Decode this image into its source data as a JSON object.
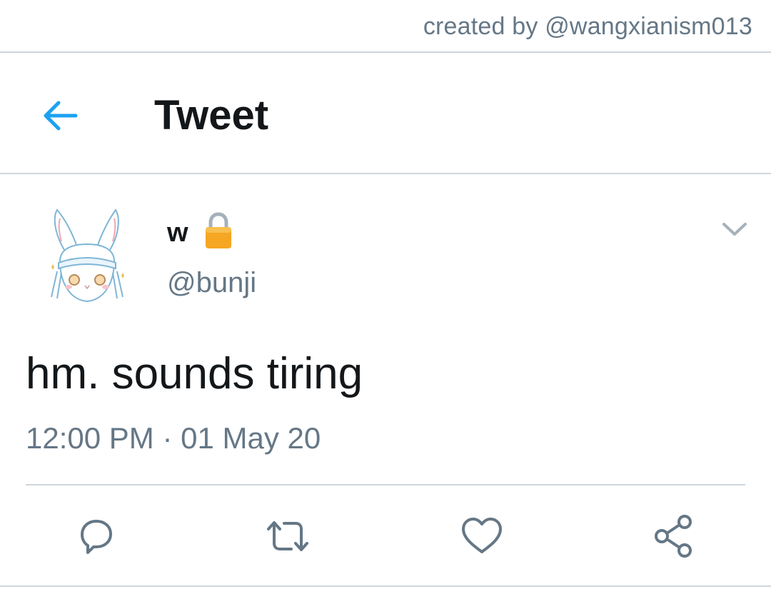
{
  "credit": "created by @wangxianism013",
  "header": {
    "title": "Tweet",
    "back_icon": "back-arrow-icon"
  },
  "tweet": {
    "display_name": "w",
    "protected_icon": "lock-icon",
    "handle": "@bunji",
    "text": "hm. sounds tiring",
    "time": "12:00 PM",
    "separator": "·",
    "date": "01 May 20"
  },
  "actions": [
    {
      "icon": "reply-icon"
    },
    {
      "icon": "retweet-icon"
    },
    {
      "icon": "like-icon"
    },
    {
      "icon": "share-icon"
    }
  ],
  "colors": {
    "accent": "#1da1f2",
    "text_primary": "#14171a",
    "text_secondary": "#657786",
    "divider": "#ccd6dd",
    "lock": "#f5a623"
  }
}
